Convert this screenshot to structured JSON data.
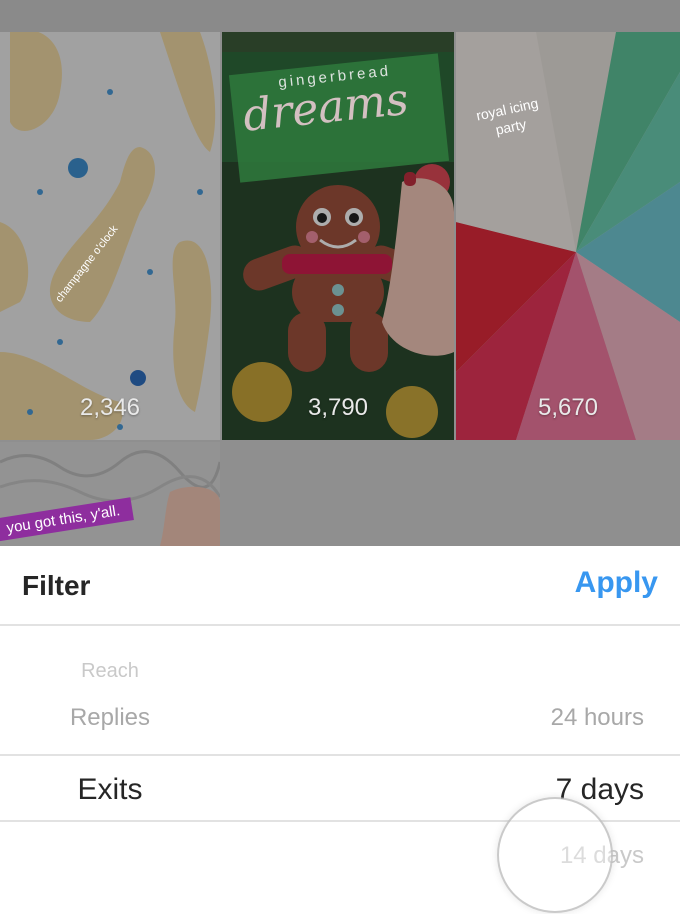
{
  "stories": [
    {
      "caption": "champagne o'clock",
      "count": "2,346"
    },
    {
      "caption_top": "gingerbread",
      "caption_script": "dreams",
      "count": "3,790"
    },
    {
      "caption": "royal icing party",
      "count": "5,670"
    },
    {
      "caption": "you got this, y'all.",
      "count": ""
    }
  ],
  "filter_sheet": {
    "title": "Filter",
    "apply_label": "Apply",
    "metric_options": [
      "Reach",
      "Replies",
      "Exits"
    ],
    "selected_metric": "Exits",
    "period_options": [
      "24 hours",
      "7 days",
      "14 days"
    ],
    "selected_period": "7 days"
  },
  "colors": {
    "accent": "#3897f0"
  }
}
